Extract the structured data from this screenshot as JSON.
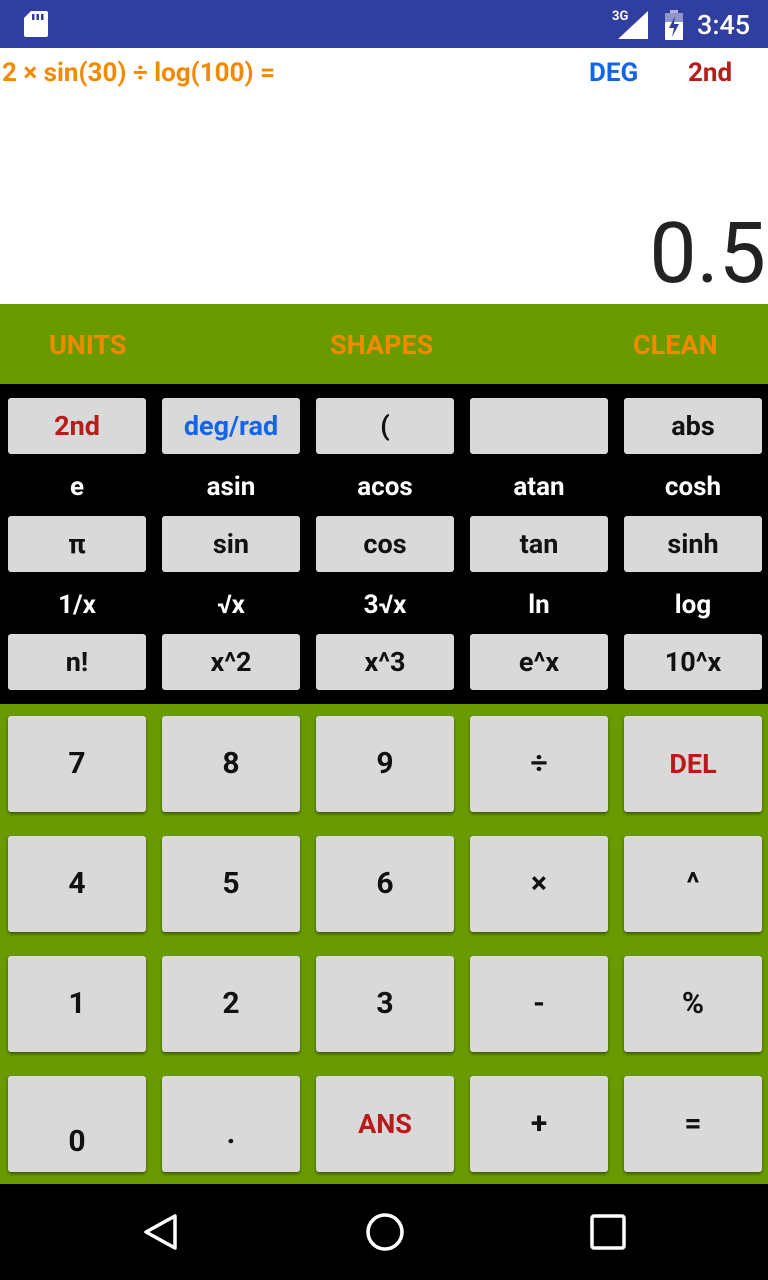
{
  "status": {
    "network": "3G",
    "time": "3:45"
  },
  "display": {
    "expression": "2 × sin(30) ÷ log(100) =",
    "angle_mode": "DEG",
    "second_mode": "2nd",
    "result": "0.5"
  },
  "tabs": {
    "units": "UNITS",
    "shapes": "SHAPES",
    "clean": "CLEAN"
  },
  "sci": {
    "row1": [
      "2nd",
      "deg/rad",
      "(",
      "",
      "abs"
    ],
    "labels1": [
      "e",
      "asin",
      "acos",
      "atan",
      "cosh"
    ],
    "row2": [
      "π",
      "sin",
      "cos",
      "tan",
      "sinh"
    ],
    "labels2": [
      "1/x",
      "√x",
      "3√x",
      "ln",
      "log"
    ],
    "row3": [
      "n!",
      "x^2",
      "x^3",
      "e^x",
      "10^x"
    ]
  },
  "keypad": {
    "row1": [
      "7",
      "8",
      "9",
      "÷",
      "DEL"
    ],
    "row2": [
      "4",
      "5",
      "6",
      "×",
      "^"
    ],
    "row3": [
      "1",
      "2",
      "3",
      "-",
      "%"
    ],
    "row4": [
      "0",
      ".",
      "ANS",
      "+",
      "="
    ]
  },
  "colors": {
    "status_bar": "#303f9f",
    "panel_green": "#699b00",
    "orange": "#f28a00",
    "red": "#b71c1c",
    "blue": "#1565e8",
    "key": "#d9d9d9"
  },
  "icons": {
    "status": [
      "sd-card-icon",
      "signal-icon",
      "battery-icon"
    ],
    "nav": [
      "back-icon",
      "home-icon",
      "recents-icon"
    ]
  }
}
